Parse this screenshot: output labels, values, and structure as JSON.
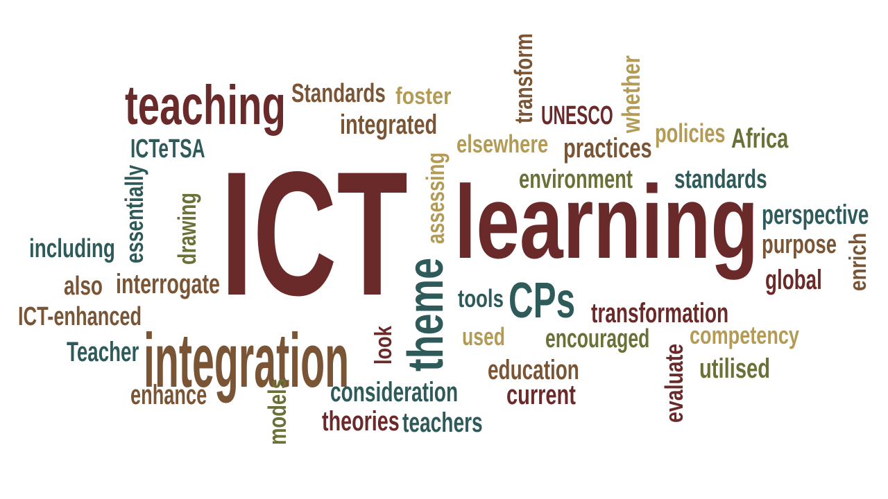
{
  "palette": {
    "maroon": "#6b2a2a",
    "brown": "#7a5535",
    "gold": "#b39a55",
    "olive": "#6b7136",
    "teal": "#2f5a5a"
  },
  "words": [
    {
      "text": "ICT",
      "color": "maroon"
    },
    {
      "text": "learning",
      "color": "maroon"
    },
    {
      "text": "teaching",
      "color": "maroon"
    },
    {
      "text": "integration",
      "color": "brown"
    },
    {
      "text": "theme",
      "color": "teal"
    },
    {
      "text": "CPs",
      "color": "teal"
    },
    {
      "text": "Standards",
      "color": "brown"
    },
    {
      "text": "foster",
      "color": "gold"
    },
    {
      "text": "integrated",
      "color": "brown"
    },
    {
      "text": "transform",
      "color": "brown"
    },
    {
      "text": "UNESCO",
      "color": "maroon"
    },
    {
      "text": "whether",
      "color": "gold"
    },
    {
      "text": "elsewhere",
      "color": "gold"
    },
    {
      "text": "practices",
      "color": "brown"
    },
    {
      "text": "policies",
      "color": "gold"
    },
    {
      "text": "Africa",
      "color": "olive"
    },
    {
      "text": "ICTeTSA",
      "color": "teal"
    },
    {
      "text": "assessing",
      "color": "gold"
    },
    {
      "text": "environment",
      "color": "olive"
    },
    {
      "text": "standards",
      "color": "teal"
    },
    {
      "text": "essentially",
      "color": "teal"
    },
    {
      "text": "drawing",
      "color": "olive"
    },
    {
      "text": "perspective",
      "color": "teal"
    },
    {
      "text": "purpose",
      "color": "brown"
    },
    {
      "text": "enrich",
      "color": "brown"
    },
    {
      "text": "including",
      "color": "teal"
    },
    {
      "text": "global",
      "color": "maroon"
    },
    {
      "text": "also",
      "color": "brown"
    },
    {
      "text": "interrogate",
      "color": "brown"
    },
    {
      "text": "tools",
      "color": "teal"
    },
    {
      "text": "transformation",
      "color": "maroon"
    },
    {
      "text": "ICT-enhanced",
      "color": "brown"
    },
    {
      "text": "used",
      "color": "gold"
    },
    {
      "text": "encouraged",
      "color": "olive"
    },
    {
      "text": "competency",
      "color": "gold"
    },
    {
      "text": "Teacher",
      "color": "teal"
    },
    {
      "text": "look",
      "color": "maroon"
    },
    {
      "text": "education",
      "color": "brown"
    },
    {
      "text": "evaluate",
      "color": "maroon"
    },
    {
      "text": "utilised",
      "color": "olive"
    },
    {
      "text": "enhance",
      "color": "brown"
    },
    {
      "text": "models",
      "color": "olive"
    },
    {
      "text": "consideration",
      "color": "teal"
    },
    {
      "text": "current",
      "color": "maroon"
    },
    {
      "text": "theories",
      "color": "maroon"
    },
    {
      "text": "teachers",
      "color": "teal"
    }
  ]
}
